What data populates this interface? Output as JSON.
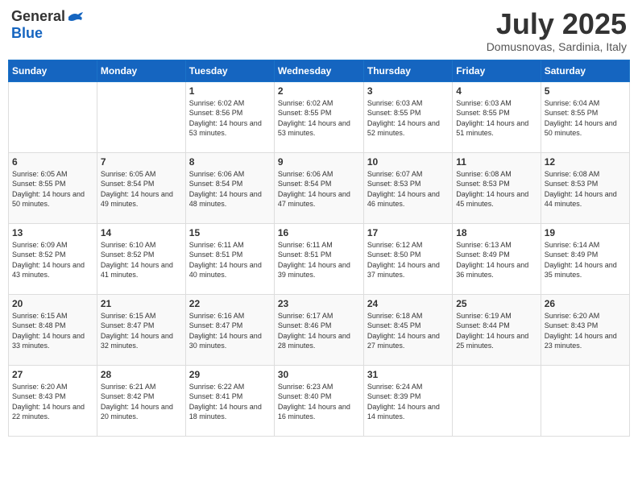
{
  "header": {
    "logo_general": "General",
    "logo_blue": "Blue",
    "month_year": "July 2025",
    "location": "Domusnovas, Sardinia, Italy"
  },
  "weekdays": [
    "Sunday",
    "Monday",
    "Tuesday",
    "Wednesday",
    "Thursday",
    "Friday",
    "Saturday"
  ],
  "weeks": [
    [
      {
        "day": "",
        "info": ""
      },
      {
        "day": "",
        "info": ""
      },
      {
        "day": "1",
        "info": "Sunrise: 6:02 AM\nSunset: 8:56 PM\nDaylight: 14 hours and 53 minutes."
      },
      {
        "day": "2",
        "info": "Sunrise: 6:02 AM\nSunset: 8:55 PM\nDaylight: 14 hours and 53 minutes."
      },
      {
        "day": "3",
        "info": "Sunrise: 6:03 AM\nSunset: 8:55 PM\nDaylight: 14 hours and 52 minutes."
      },
      {
        "day": "4",
        "info": "Sunrise: 6:03 AM\nSunset: 8:55 PM\nDaylight: 14 hours and 51 minutes."
      },
      {
        "day": "5",
        "info": "Sunrise: 6:04 AM\nSunset: 8:55 PM\nDaylight: 14 hours and 50 minutes."
      }
    ],
    [
      {
        "day": "6",
        "info": "Sunrise: 6:05 AM\nSunset: 8:55 PM\nDaylight: 14 hours and 50 minutes."
      },
      {
        "day": "7",
        "info": "Sunrise: 6:05 AM\nSunset: 8:54 PM\nDaylight: 14 hours and 49 minutes."
      },
      {
        "day": "8",
        "info": "Sunrise: 6:06 AM\nSunset: 8:54 PM\nDaylight: 14 hours and 48 minutes."
      },
      {
        "day": "9",
        "info": "Sunrise: 6:06 AM\nSunset: 8:54 PM\nDaylight: 14 hours and 47 minutes."
      },
      {
        "day": "10",
        "info": "Sunrise: 6:07 AM\nSunset: 8:53 PM\nDaylight: 14 hours and 46 minutes."
      },
      {
        "day": "11",
        "info": "Sunrise: 6:08 AM\nSunset: 8:53 PM\nDaylight: 14 hours and 45 minutes."
      },
      {
        "day": "12",
        "info": "Sunrise: 6:08 AM\nSunset: 8:53 PM\nDaylight: 14 hours and 44 minutes."
      }
    ],
    [
      {
        "day": "13",
        "info": "Sunrise: 6:09 AM\nSunset: 8:52 PM\nDaylight: 14 hours and 43 minutes."
      },
      {
        "day": "14",
        "info": "Sunrise: 6:10 AM\nSunset: 8:52 PM\nDaylight: 14 hours and 41 minutes."
      },
      {
        "day": "15",
        "info": "Sunrise: 6:11 AM\nSunset: 8:51 PM\nDaylight: 14 hours and 40 minutes."
      },
      {
        "day": "16",
        "info": "Sunrise: 6:11 AM\nSunset: 8:51 PM\nDaylight: 14 hours and 39 minutes."
      },
      {
        "day": "17",
        "info": "Sunrise: 6:12 AM\nSunset: 8:50 PM\nDaylight: 14 hours and 37 minutes."
      },
      {
        "day": "18",
        "info": "Sunrise: 6:13 AM\nSunset: 8:49 PM\nDaylight: 14 hours and 36 minutes."
      },
      {
        "day": "19",
        "info": "Sunrise: 6:14 AM\nSunset: 8:49 PM\nDaylight: 14 hours and 35 minutes."
      }
    ],
    [
      {
        "day": "20",
        "info": "Sunrise: 6:15 AM\nSunset: 8:48 PM\nDaylight: 14 hours and 33 minutes."
      },
      {
        "day": "21",
        "info": "Sunrise: 6:15 AM\nSunset: 8:47 PM\nDaylight: 14 hours and 32 minutes."
      },
      {
        "day": "22",
        "info": "Sunrise: 6:16 AM\nSunset: 8:47 PM\nDaylight: 14 hours and 30 minutes."
      },
      {
        "day": "23",
        "info": "Sunrise: 6:17 AM\nSunset: 8:46 PM\nDaylight: 14 hours and 28 minutes."
      },
      {
        "day": "24",
        "info": "Sunrise: 6:18 AM\nSunset: 8:45 PM\nDaylight: 14 hours and 27 minutes."
      },
      {
        "day": "25",
        "info": "Sunrise: 6:19 AM\nSunset: 8:44 PM\nDaylight: 14 hours and 25 minutes."
      },
      {
        "day": "26",
        "info": "Sunrise: 6:20 AM\nSunset: 8:43 PM\nDaylight: 14 hours and 23 minutes."
      }
    ],
    [
      {
        "day": "27",
        "info": "Sunrise: 6:20 AM\nSunset: 8:43 PM\nDaylight: 14 hours and 22 minutes."
      },
      {
        "day": "28",
        "info": "Sunrise: 6:21 AM\nSunset: 8:42 PM\nDaylight: 14 hours and 20 minutes."
      },
      {
        "day": "29",
        "info": "Sunrise: 6:22 AM\nSunset: 8:41 PM\nDaylight: 14 hours and 18 minutes."
      },
      {
        "day": "30",
        "info": "Sunrise: 6:23 AM\nSunset: 8:40 PM\nDaylight: 14 hours and 16 minutes."
      },
      {
        "day": "31",
        "info": "Sunrise: 6:24 AM\nSunset: 8:39 PM\nDaylight: 14 hours and 14 minutes."
      },
      {
        "day": "",
        "info": ""
      },
      {
        "day": "",
        "info": ""
      }
    ]
  ]
}
